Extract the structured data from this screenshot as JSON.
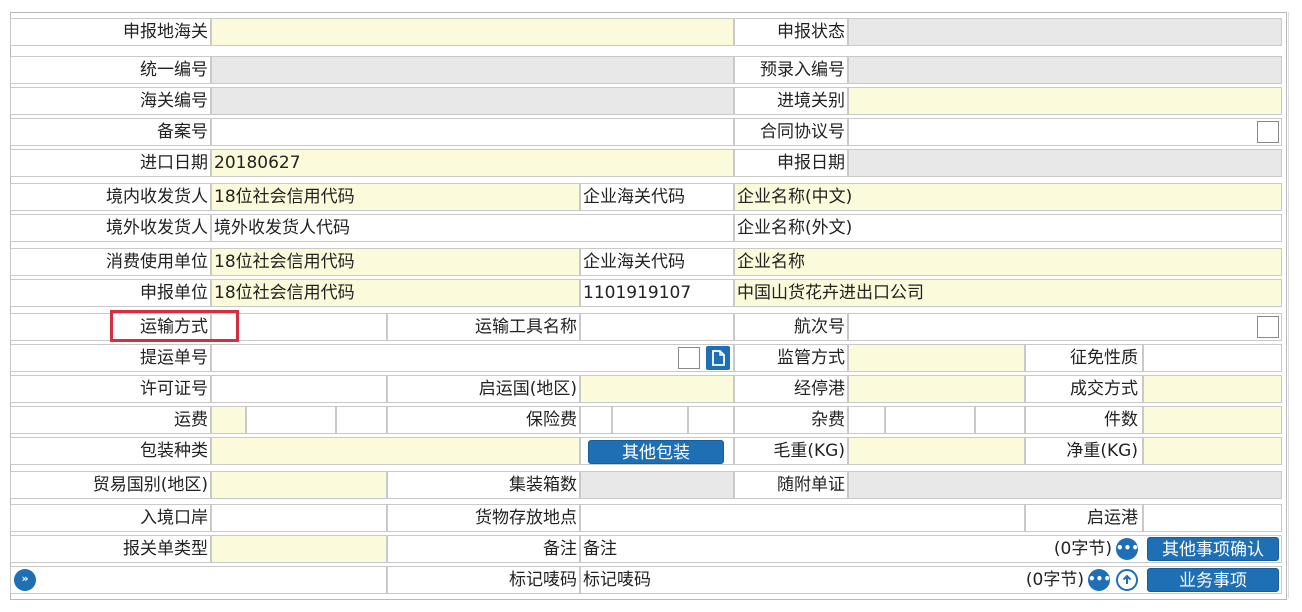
{
  "form": {
    "r1": {
      "declare_customs": "申报地海关",
      "declare_status": "申报状态"
    },
    "r2": {
      "unified_no": "统一编号",
      "pre_entry_no": "预录入编号"
    },
    "r3": {
      "customs_no": "海关编号",
      "entry_customs": "进境关别"
    },
    "r4": {
      "record_no": "备案号",
      "contract_no": "合同协议号"
    },
    "r5": {
      "import_date": "进口日期",
      "import_date_value": "20180627",
      "declare_date": "申报日期"
    },
    "r6": {
      "label": "境内收发货人",
      "value": "18位社会信用代码",
      "customs_code_label": "企业海关代码",
      "name_value": "企业名称(中文)"
    },
    "r7": {
      "label": "境外收发货人",
      "value": "境外收发货人代码",
      "name_value": "企业名称(外文)"
    },
    "r8": {
      "label": "消费使用单位",
      "value": "18位社会信用代码",
      "customs_code_label": "企业海关代码",
      "name_value": "企业名称"
    },
    "r9": {
      "label": "申报单位",
      "value": "18位社会信用代码",
      "customs_code": "1101919107",
      "company_name": "中国山货花卉进出口公司"
    },
    "r10": {
      "transport_mode": "运输方式",
      "vehicle_name": "运输工具名称",
      "voyage_no": "航次号"
    },
    "r11": {
      "bill_no": "提运单号",
      "supervision_mode": "监管方式",
      "levy_nature": "征免性质"
    },
    "r12": {
      "license_no": "许可证号",
      "departure_country": "启运国(地区)",
      "stop_port": "经停港",
      "deal_mode": "成交方式"
    },
    "r13": {
      "freight": "运费",
      "insurance": "保险费",
      "misc_fee": "杂费",
      "pieces": "件数"
    },
    "r14": {
      "package_type": "包装种类",
      "other_packaging_btn": "其他包装",
      "gross_weight": "毛重(KG)",
      "net_weight": "净重(KG)"
    },
    "r15": {
      "trade_country": "贸易国别(地区)",
      "container_count": "集装箱数",
      "attached_docs": "随附单证"
    },
    "r16": {
      "entry_port": "入境口岸",
      "storage_place": "货物存放地点",
      "departure_port": "启运港"
    },
    "r17": {
      "decl_type": "报关单类型",
      "remarks_label": "备注",
      "remarks_value": "备注",
      "byte_count": "(0字节)",
      "other_confirm_btn": "其他事项确认"
    },
    "r18": {
      "marks_label": "标记唛码",
      "marks_value": "标记唛码",
      "byte_count": "(0字节)",
      "business_btn": "业务事项"
    }
  },
  "icons": {
    "more": "more-dots-icon",
    "up": "arrow-up-circle-icon",
    "expand": "double-chevron-icon",
    "doc": "document-icon"
  },
  "colors": {
    "editable_yellow": "#fbfadb",
    "readonly_gray": "#e8e8e8",
    "button_blue": "#1f6fb4",
    "highlight_red": "#d32f3f"
  }
}
